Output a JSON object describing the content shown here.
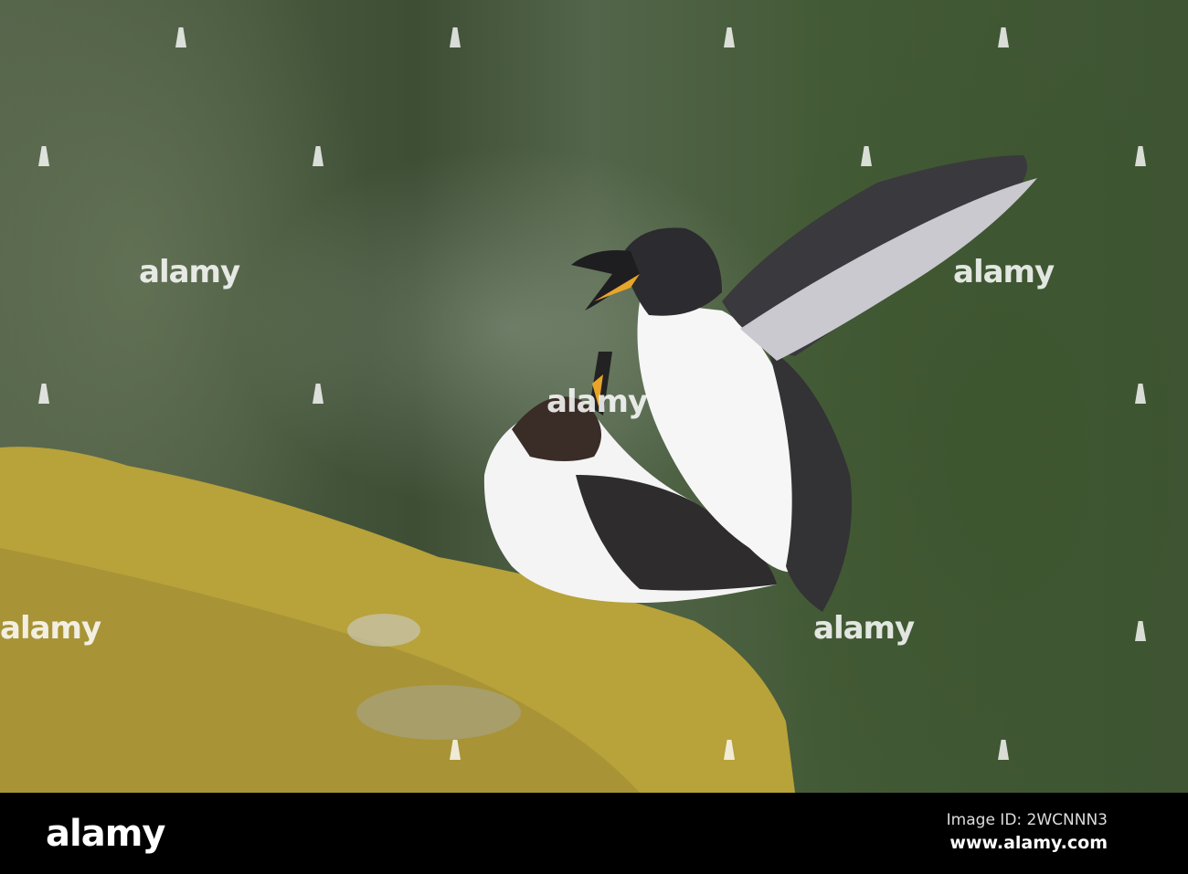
{
  "watermark": {
    "text": "alamy"
  },
  "footer": {
    "logo": "alamy",
    "image_id": "Image ID: 2WCNNN3",
    "url": "www.alamy.com"
  }
}
